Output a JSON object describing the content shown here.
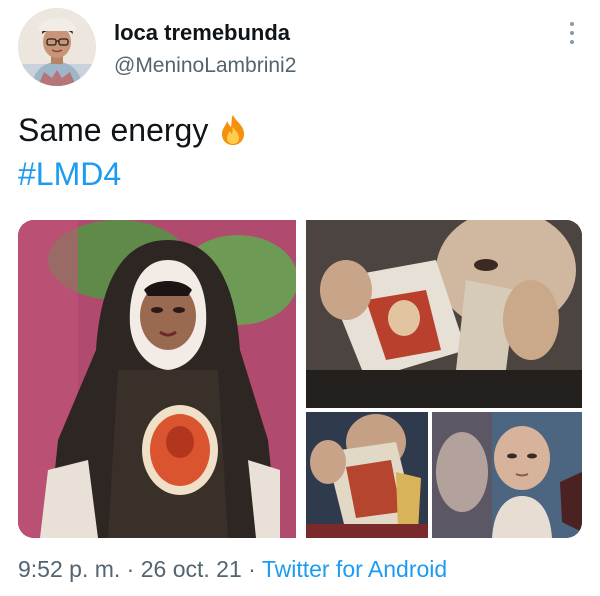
{
  "author": {
    "display_name": "loca tremebunda",
    "handle": "@MeninoLambrini2",
    "avatar_icon": "profile-avatar"
  },
  "tweet": {
    "text": "Same energy",
    "emoji_icon": "fire-emoji-icon",
    "hashtag": "#LMD4"
  },
  "media": {
    "images": [
      {
        "name": "drag-queen-nun-image"
      },
      {
        "name": "photo-tearing-image"
      },
      {
        "name": "photo-tearing-closeup-image"
      },
      {
        "name": "shaved-head-woman-image"
      }
    ]
  },
  "meta": {
    "time": "9:52 p. m.",
    "separator": "·",
    "date": "26 oct. 21",
    "source": "Twitter for Android"
  },
  "colors": {
    "link": "#1d9bf0",
    "secondary_text": "#536471"
  }
}
